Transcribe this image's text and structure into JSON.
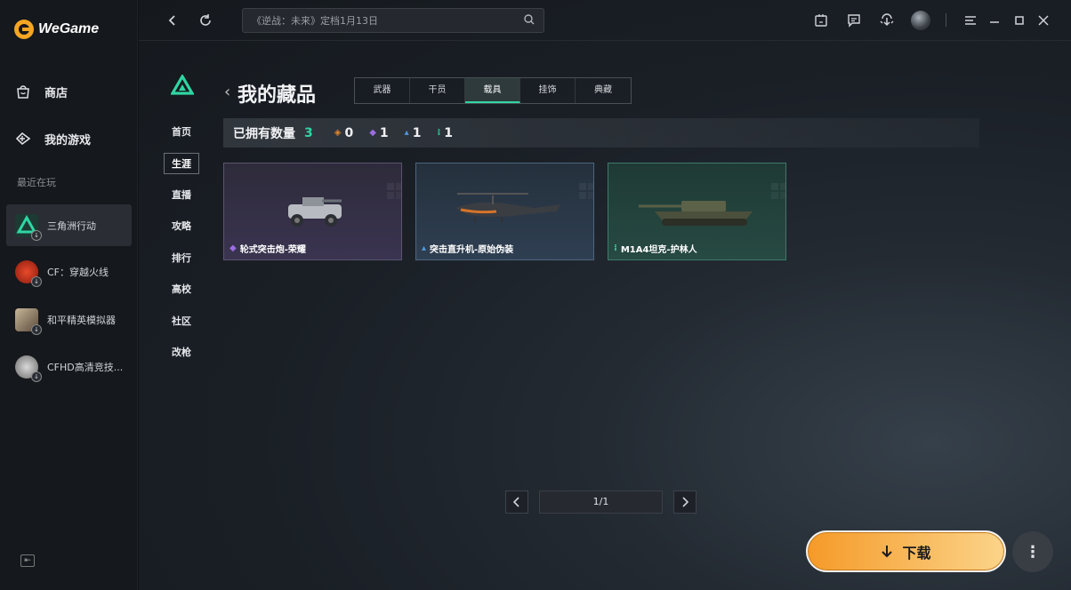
{
  "app": {
    "logo_text": "WeGame"
  },
  "sidebar": {
    "nav": [
      {
        "label": "商店",
        "icon": "shop-bag-icon"
      },
      {
        "label": "我的游戏",
        "icon": "game-controller-icon"
      }
    ],
    "recent_title": "最近在玩",
    "games": [
      {
        "label": "三角洲行动",
        "active": true
      },
      {
        "label": "CF：穿越火线"
      },
      {
        "label": "和平精英模拟器"
      },
      {
        "label": "CFHD高清竞技..."
      }
    ]
  },
  "topbar": {
    "search_placeholder": "《逆战：未来》定档1月13日"
  },
  "subnav": {
    "items": [
      "首页",
      "生涯",
      "直播",
      "攻略",
      "排行",
      "高校",
      "社区",
      "改枪"
    ],
    "active_index": 1
  },
  "collection": {
    "title": "我的藏品",
    "tabs": [
      "武器",
      "干员",
      "载具",
      "挂饰",
      "典藏"
    ],
    "active_tab": 2,
    "owned_label": "已拥有数量",
    "owned_count": "3",
    "rarity_counts": [
      {
        "color": "#e0882c",
        "value": "0"
      },
      {
        "color": "#9a6ee0",
        "value": "1"
      },
      {
        "color": "#4a9be0",
        "value": "1"
      },
      {
        "color": "#2fd6a4",
        "value": "1"
      }
    ],
    "items": [
      {
        "name": "轮式突击炮-荣耀",
        "rarity_color": "#9a6ee0",
        "bg": "purple"
      },
      {
        "name": "突击直升机-原始伪装",
        "rarity_color": "#4a9be0",
        "bg": "blue"
      },
      {
        "name": "M1A4坦克-护林人",
        "rarity_color": "#2fd6a4",
        "bg": "green"
      }
    ]
  },
  "pagination": {
    "indicator": "1/1"
  },
  "actions": {
    "download_label": "下载"
  }
}
